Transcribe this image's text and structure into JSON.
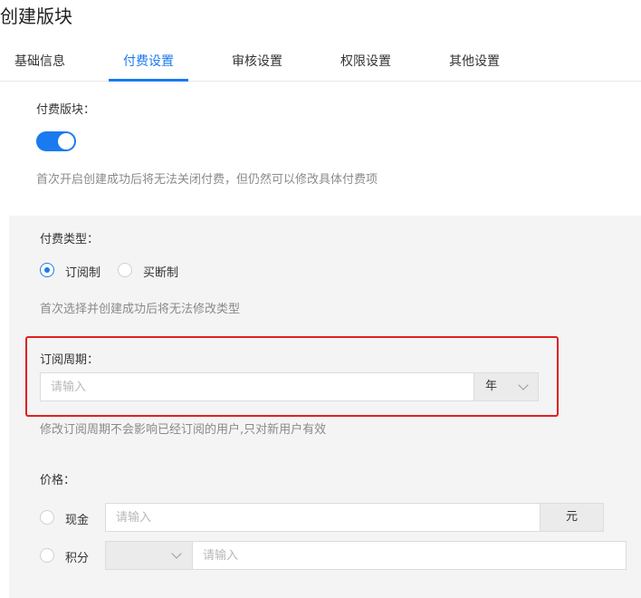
{
  "page": {
    "title": "创建版块"
  },
  "tabs": [
    {
      "label": "基础信息"
    },
    {
      "label": "付费设置"
    },
    {
      "label": "审核设置"
    },
    {
      "label": "权限设置"
    },
    {
      "label": "其他设置"
    }
  ],
  "paid_section": {
    "label": "付费版块：",
    "enabled": true,
    "hint": "首次开启创建成功后将无法关闭付费，但仍然可以修改具体付费项"
  },
  "pay_type": {
    "label": "付费类型：",
    "options": [
      {
        "label": "订阅制",
        "checked": true
      },
      {
        "label": "买断制",
        "checked": false
      }
    ],
    "hint": "首次选择并创建成功后将无法修改类型"
  },
  "subscription": {
    "label": "订阅周期：",
    "placeholder": "请输入",
    "unit": "年",
    "hint": "修改订阅周期不会影响已经订阅的用户,只对新用户有效"
  },
  "price": {
    "label": "价格：",
    "cash": {
      "label": "现金",
      "placeholder": "请输入",
      "unit": "元"
    },
    "points": {
      "label": "积分",
      "placeholder": "请输入"
    }
  },
  "colors": {
    "accent": "#1a7af0",
    "highlight": "#e02020",
    "panel": "#f4f4f4"
  }
}
